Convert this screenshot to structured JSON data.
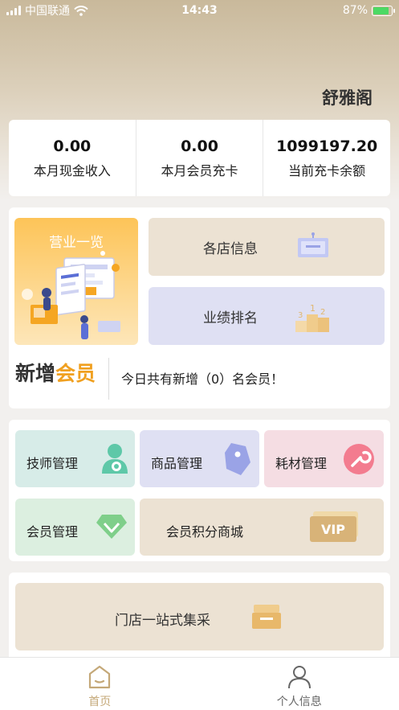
{
  "status_bar": {
    "carrier": "中国联通",
    "time": "14:43",
    "battery": "87%",
    "battery_level": 0.87
  },
  "header": {
    "shop_name": "舒雅阁"
  },
  "stats": [
    {
      "value": "0.00",
      "label": "本月现金收入"
    },
    {
      "value": "0.00",
      "label": "本月会员充卡"
    },
    {
      "value": "1099197.20",
      "label": "当前充卡余额"
    }
  ],
  "overview": {
    "title": "营业一览",
    "store_info": "各店信息",
    "ranking": "业绩排名",
    "new_member_logo_a": "新增",
    "new_member_logo_b": "会员",
    "new_member_text": "今日共有新增（0）名会员！"
  },
  "management": {
    "technician": "技师管理",
    "goods": "商品管理",
    "consumables": "耗材管理",
    "member": "会员管理",
    "points_mall": "会员积分商城",
    "vip_badge": "VIP"
  },
  "procurement": {
    "label": "门店一站式集采"
  },
  "tabs": [
    {
      "label": "首页",
      "active": true
    },
    {
      "label": "个人信息",
      "active": false
    }
  ],
  "colors": {
    "accent": "#c4a878",
    "tile_beige": "#ece2d3",
    "tile_lavender": "#dfe0f3",
    "tile_mint": "#d7ece8",
    "tile_pink": "#f5dde3",
    "tile_green": "#dcefe0",
    "orange": "#f0a020"
  }
}
